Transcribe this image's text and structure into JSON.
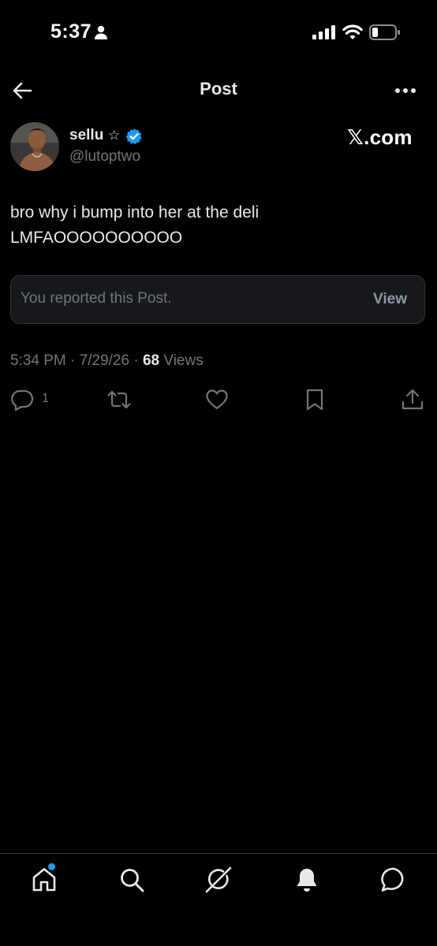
{
  "status_bar": {
    "time": "5:37"
  },
  "header": {
    "title": "Post"
  },
  "author": {
    "display_name": "sellu",
    "name_suffix": "☆",
    "handle": "@lutoptwo",
    "verified": true,
    "verified_color": "#1d9bf0"
  },
  "watermark": "𝕏.com",
  "post": {
    "text": "bro why i bump into her at the deli\nLMFAOOOOOOOOOO"
  },
  "report_notice": {
    "message": "You reported this Post.",
    "action_label": "View"
  },
  "meta": {
    "time": "5:34 PM",
    "date": "7/29/26",
    "views_count": "68",
    "views_label": "Views",
    "separator": "·"
  },
  "actions": {
    "reply_count": "1",
    "icons": [
      "reply-icon",
      "repost-icon",
      "like-icon",
      "bookmark-icon",
      "share-icon"
    ]
  },
  "bottom_nav": {
    "items": [
      "home-icon",
      "search-icon",
      "grok-icon",
      "notifications-icon",
      "messages-icon"
    ],
    "home_has_badge": true
  },
  "colors": {
    "background": "#000000",
    "text_primary": "#e7e9ea",
    "text_secondary": "#71767b",
    "accent": "#1d9bf0",
    "card_bg": "#16181c",
    "border": "#2f3336"
  }
}
